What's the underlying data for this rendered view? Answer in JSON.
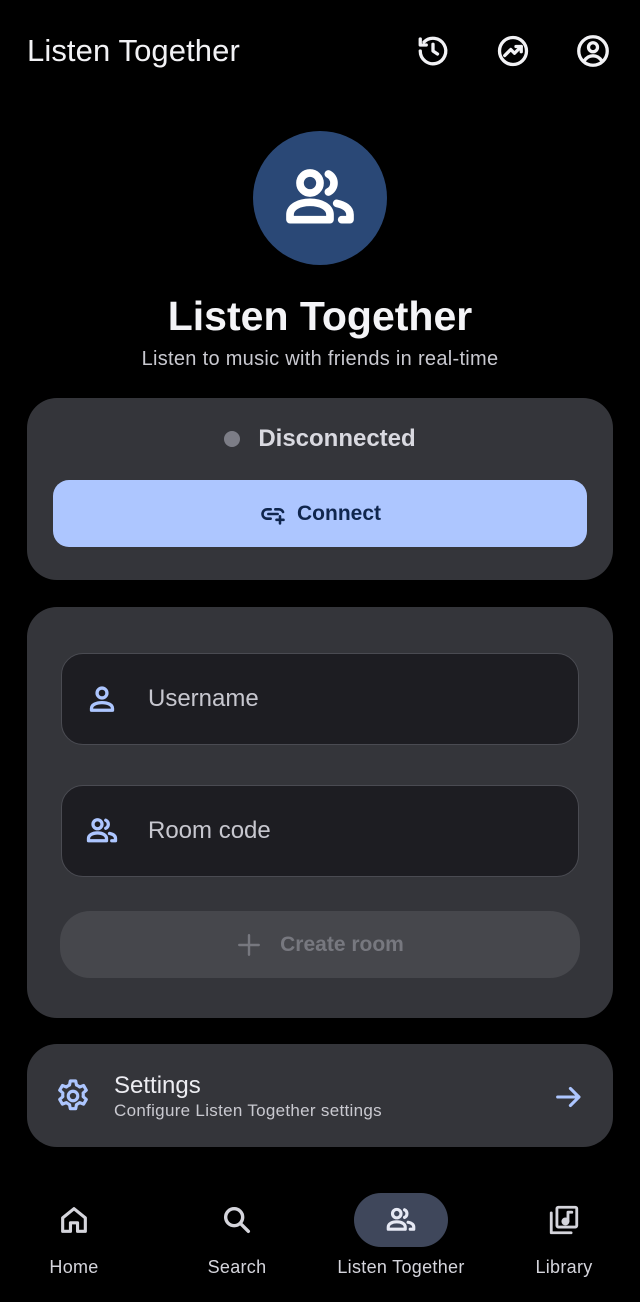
{
  "app_bar": {
    "title": "Listen Together",
    "icons": [
      "history-icon",
      "trending-icon",
      "account-icon"
    ]
  },
  "hero": {
    "icon": "people-icon",
    "title": "Listen Together",
    "subtitle": "Listen to music with friends in real-time"
  },
  "status": {
    "text": "Disconnected",
    "dot_color": "#7c7d86",
    "connect_label": "Connect",
    "connect_icon": "add-link-icon"
  },
  "form": {
    "username_placeholder": "Username",
    "username_value": "",
    "room_placeholder": "Room code",
    "room_value": "",
    "create_label": "Create room",
    "create_icon": "plus-icon"
  },
  "settings": {
    "title": "Settings",
    "subtitle": "Configure Listen Together settings",
    "icon": "gear-icon",
    "arrow_icon": "arrow-right-icon"
  },
  "nav": {
    "items": [
      {
        "label": "Home",
        "icon": "home-icon",
        "active": false
      },
      {
        "label": "Search",
        "icon": "search-icon",
        "active": false
      },
      {
        "label": "Listen Together",
        "icon": "people-icon",
        "active": true
      },
      {
        "label": "Library",
        "icon": "library-music-icon",
        "active": false
      }
    ]
  },
  "colors": {
    "background": "#000000",
    "card": "#34353a",
    "accent": "#adc6ff",
    "hero_circle": "#2a4876",
    "nav_active": "#3f475b"
  }
}
